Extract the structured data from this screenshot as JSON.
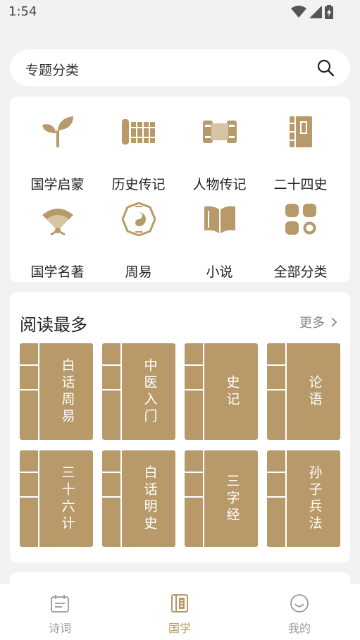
{
  "status": {
    "time": "1:54"
  },
  "search": {
    "label": "专题分类"
  },
  "categories": [
    {
      "label": "国学启蒙",
      "icon": "sprout-icon"
    },
    {
      "label": "历史传记",
      "icon": "bamboo-slips-icon"
    },
    {
      "label": "人物传记",
      "icon": "scroll-icon"
    },
    {
      "label": "二十四史",
      "icon": "book-icon"
    },
    {
      "label": "国学名著",
      "icon": "fan-icon"
    },
    {
      "label": "周易",
      "icon": "bagua-icon"
    },
    {
      "label": "小说",
      "icon": "open-book-icon"
    },
    {
      "label": "全部分类",
      "icon": "grid-icon"
    }
  ],
  "most_read": {
    "title": "阅读最多",
    "more": "更多",
    "books": [
      "白话周易",
      "中医入门",
      "史记",
      "论语",
      "三十六计",
      "白话明史",
      "三字经",
      "孙子兵法"
    ]
  },
  "tabs": [
    {
      "label": "诗词",
      "icon": "calendar-icon",
      "active": false
    },
    {
      "label": "国学",
      "icon": "book-icon",
      "active": true
    },
    {
      "label": "我的",
      "icon": "smile-icon",
      "active": false
    }
  ],
  "colors": {
    "accent": "#b89a6a",
    "background": "#f3f2f0"
  }
}
